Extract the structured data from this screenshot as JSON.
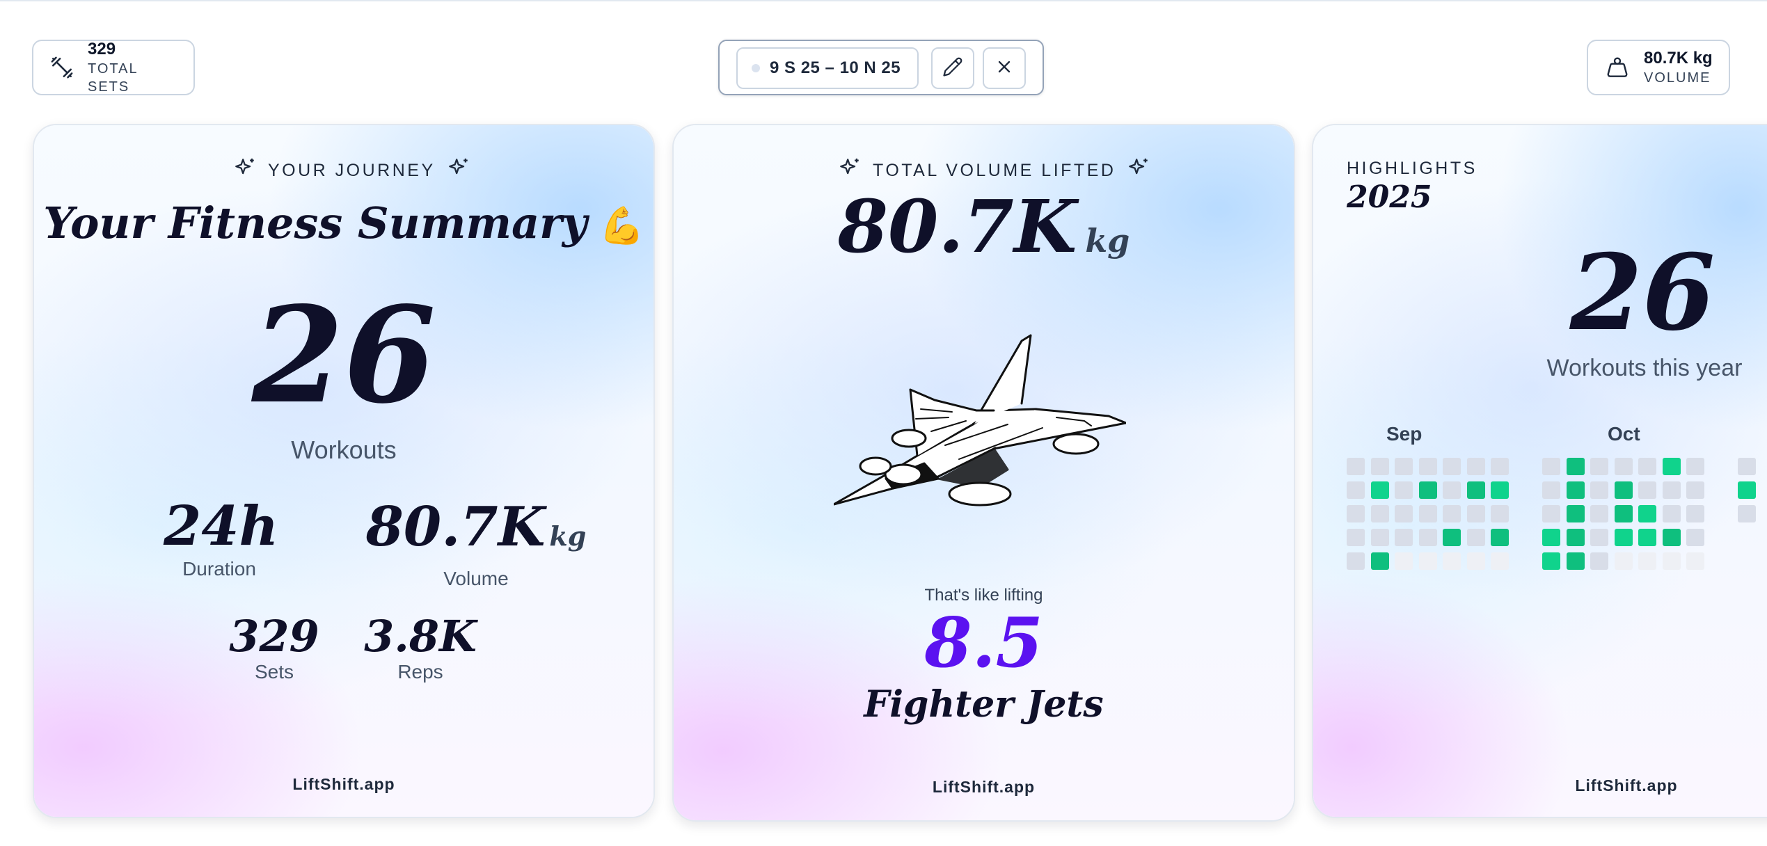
{
  "colors": {
    "accent_purple": "#5b12f0",
    "heat_green": "#10d38c",
    "heat_green_dark": "#0fbf7e",
    "heat_empty": "#d8dde8",
    "heat_future": "#eef0f5"
  },
  "header": {
    "sets_chip": {
      "value": "329",
      "label": "TOTAL SETS",
      "icon": "dumbbell-icon"
    },
    "date_range": {
      "text": "9 S 25 – 10 N 25",
      "edit_icon": "pencil-icon",
      "close_icon": "close-icon"
    },
    "volume_chip": {
      "value": "80.7K kg",
      "label": "VOLUME",
      "icon": "weight-icon"
    }
  },
  "cards": {
    "summary": {
      "eyebrow": "YOUR JOURNEY",
      "title": "Your Fitness Summary",
      "title_emoji": "💪",
      "workouts_value": "26",
      "workouts_label": "Workouts",
      "duration_value": "24h",
      "duration_label": "Duration",
      "volume_value": "80.7K",
      "volume_unit": "kg",
      "volume_label": "Volume",
      "sets_value": "329",
      "sets_label": "Sets",
      "reps_value": "3.8K",
      "reps_label": "Reps",
      "footer": "LiftShift.app"
    },
    "volume": {
      "eyebrow": "TOTAL VOLUME LIFTED",
      "value": "80.7K",
      "unit": "kg",
      "comparison_intro": "That's like lifting",
      "comparison_count": "8.5",
      "comparison_object": "Fighter Jets",
      "illustration": "fighter-jet-illustration",
      "footer": "LiftShift.app"
    },
    "highlights": {
      "eyebrow": "HIGHLIGHTS",
      "year": "2025",
      "workouts_value": "26",
      "workouts_label": "Workouts this year",
      "months": [
        {
          "name": "Sep",
          "weeks": [
            [
              0,
              0,
              0,
              0,
              0,
              0,
              0
            ],
            [
              0,
              1,
              0,
              2,
              0,
              2,
              1
            ],
            [
              0,
              0,
              0,
              0,
              0,
              0,
              0
            ],
            [
              0,
              0,
              0,
              0,
              2,
              0,
              2
            ],
            [
              0,
              2,
              -1,
              -1,
              -1,
              -1,
              -1
            ]
          ]
        },
        {
          "name": "Oct",
          "weeks": [
            [
              0,
              2,
              0,
              0,
              0,
              1,
              0
            ],
            [
              0,
              2,
              0,
              2,
              0,
              0,
              0
            ],
            [
              0,
              2,
              0,
              2,
              1,
              0,
              0
            ],
            [
              1,
              2,
              0,
              1,
              1,
              2,
              0
            ],
            [
              1,
              2,
              0,
              -1,
              -1,
              -1,
              -1
            ]
          ]
        }
      ],
      "footer": "LiftShift.app"
    }
  }
}
